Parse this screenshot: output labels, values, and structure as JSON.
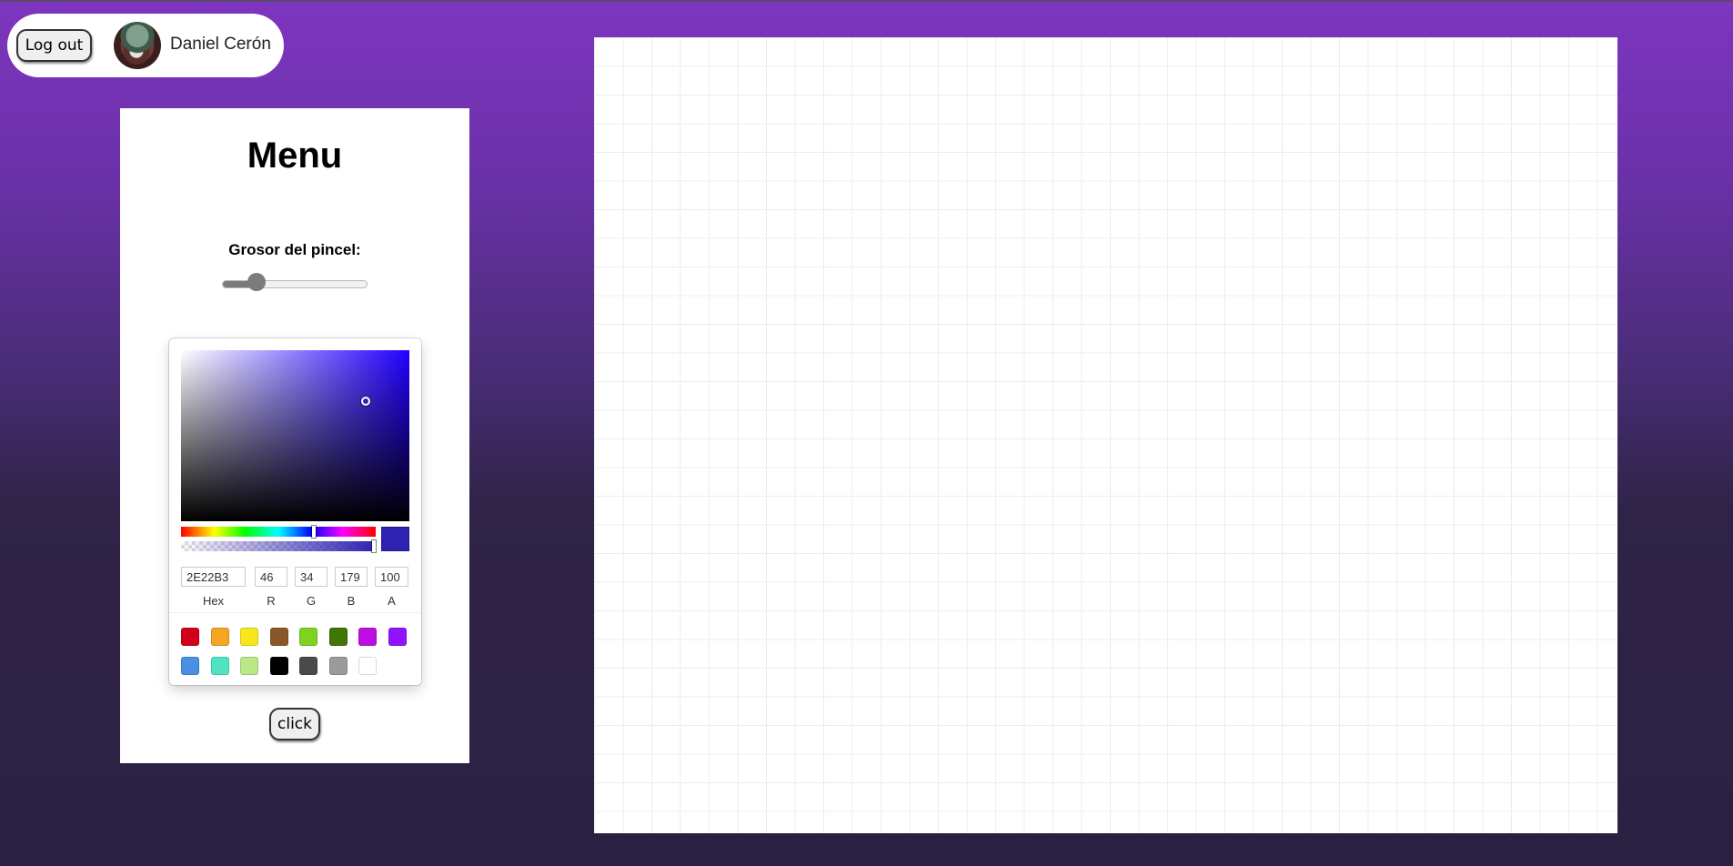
{
  "user": {
    "logout_label": "Log out",
    "name": "Daniel Cerón"
  },
  "menu": {
    "title": "Menu",
    "brush_label": "Grosor del pincel:",
    "brush_size_fraction": 0.2,
    "click_label": "click"
  },
  "color_picker": {
    "current_color": "#2E22B3",
    "hue_fraction": 0.68,
    "alpha_fraction": 1.0,
    "saturation_fraction": 0.81,
    "value_fraction": 0.7,
    "fields": {
      "hex": "2E22B3",
      "r": "46",
      "g": "34",
      "b": "179",
      "a": "100"
    },
    "labels": {
      "hex": "Hex",
      "r": "R",
      "g": "G",
      "b": "B",
      "a": "A"
    },
    "presets": [
      "#D0021B",
      "#F5A623",
      "#F8E71C",
      "#8B572A",
      "#7ED321",
      "#417505",
      "#BD10E0",
      "#9013FE",
      "#4A90E2",
      "#50E3C2",
      "#B8E986",
      "#000000",
      "#4A4A4A",
      "#9B9B9B",
      "#FFFFFF"
    ]
  }
}
